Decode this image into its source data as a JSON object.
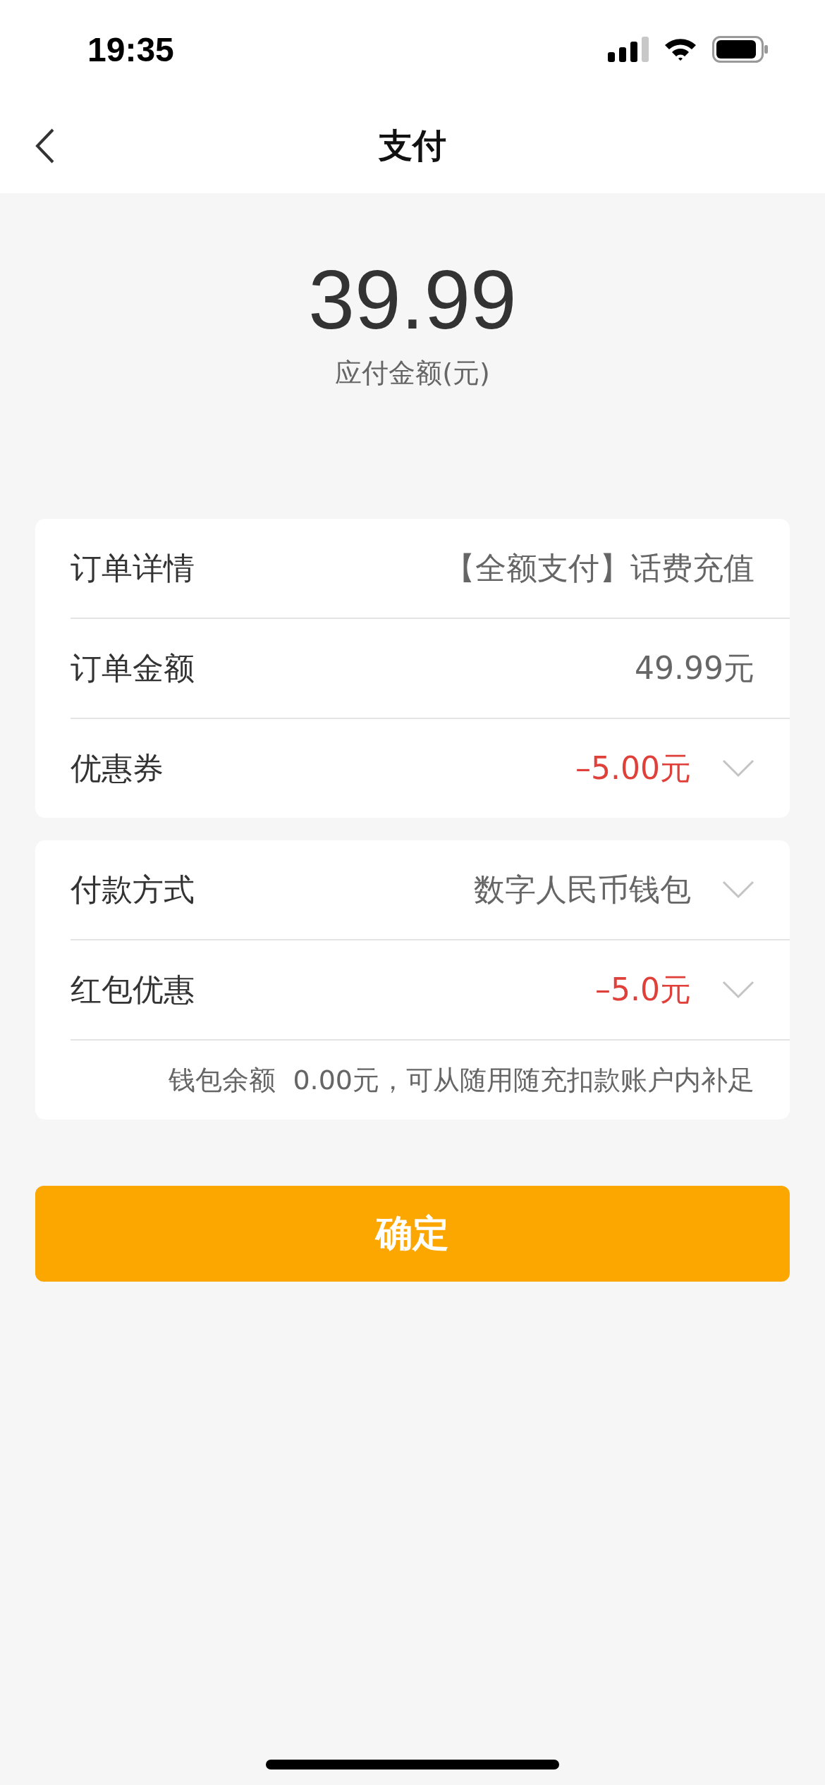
{
  "status_bar": {
    "time": "19:35"
  },
  "nav": {
    "title": "支付"
  },
  "amount": {
    "value": "39.99",
    "label": "应付金额(元)"
  },
  "order_card": {
    "rows": [
      {
        "label": "订单详情",
        "value": "【全额支付】话费充值",
        "negative": false,
        "dropdown": false
      },
      {
        "label": "订单金额",
        "value": "49.99元",
        "negative": false,
        "dropdown": false
      },
      {
        "label": "优惠券",
        "value": "–5.00元",
        "negative": true,
        "dropdown": true
      }
    ]
  },
  "payment_card": {
    "rows": [
      {
        "label": "付款方式",
        "value": "数字人民币钱包",
        "negative": false,
        "dropdown": true
      },
      {
        "label": "红包优惠",
        "value": "–5.0元",
        "negative": true,
        "dropdown": true
      }
    ],
    "note": "钱包余额  0.00元，可从随用随充扣款账户内补足"
  },
  "confirm_button": "确定"
}
